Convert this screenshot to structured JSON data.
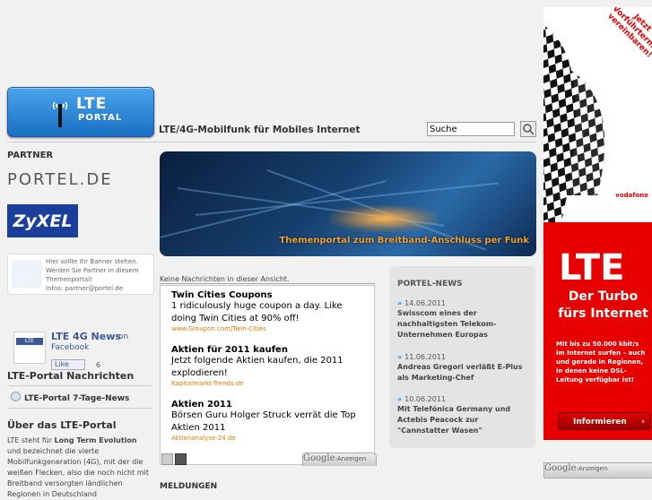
{
  "header": {
    "logo_main": "LTE",
    "logo_sub": "PORTAL",
    "tagline": "LTE/4G-Mobilfunk für Mobiles Internet",
    "search_value": "Suche"
  },
  "sidebar": {
    "partner_title": "PARTNER",
    "partner1": "PORTEL.DE",
    "partner2": "ZyXEL",
    "banner_text": "Hier sollte Ihr Banner stehen. Werden Sie Partner in diesem Themenportal!",
    "banner_contact": "Infos: partner@portel.de",
    "fb_title": "LTE 4G News",
    "fb_on": "on",
    "fb_facebook": "Facebook",
    "fb_like": "Like",
    "fb_count": "6",
    "fb_icon_text": "LTE",
    "nachrichten_title": "LTE-Portal Nachrichten",
    "nachrichten_item": "LTE-Portal 7-Tage-News",
    "about_title": "Über das LTE-Portal",
    "about_text_1": "LTE steht für ",
    "about_bold": "Long Term Evolution",
    "about_text_2": " und bezeichnet die vierte Mobilfunkgeneration (4G), mit der die weißen Flecken, also die noch nicht mit Breitband versorgten ländlichen Regionen in Deutschland"
  },
  "hero": {
    "caption": "Themenportal zum Breitband-Anschluss per Funk"
  },
  "main": {
    "no_news": "Keine Nachrichten in dieser Ansicht.",
    "ads": [
      {
        "title": "Twin Cities Coupons",
        "desc": "1 ridiculously huge coupon a day. Like doing Twin Cities at 90% off!",
        "url": "www.Groupon.com/Twin-Cities"
      },
      {
        "title": "Aktien für 2011 kaufen",
        "desc": "Jetzt folgende Aktien kaufen, die 2011 explodieren!",
        "url": "Kapitalmarkt-Trends.de"
      },
      {
        "title": "Aktien 2011",
        "desc": "Börsen Guru Holger Struck verrät die Top Aktien 2011",
        "url": "Aktienanalyse-24.de"
      }
    ],
    "google_label": "Google",
    "google_suffix": "-Anzeigen",
    "meldungen": "MELDUNGEN"
  },
  "portel_news": {
    "title": "PORTEL-NEWS",
    "items": [
      {
        "date": "14.06.2011",
        "headline": "Swisscom eines der nachhaltigsten Telekom-Unternehmen Europas"
      },
      {
        "date": "11.06.2011",
        "headline": "Andreas Gregori verläßt E-Plus als Marketing-Chef"
      },
      {
        "date": "10.06.2011",
        "headline": "Mit Telefónica Germany und Actebis Peacock zur \"Cannstatter Wasen\""
      }
    ]
  },
  "right_ad": {
    "corner": "Jetzt Vorführtermin vereinbaren!",
    "brand": "vodafone",
    "lte": "LTE",
    "turbo": "Der Turbo fürs Internet",
    "body": "Mit bis zu 50.000 kbit/s im Internet surfen – auch und gerade in Regionen, in denen keine DSL-Leitung verfügbar ist!",
    "button": "Informieren"
  },
  "colors": {
    "accent": "#2a8ad6",
    "brand_red": "#e60000",
    "ad_url": "#e07b00"
  }
}
